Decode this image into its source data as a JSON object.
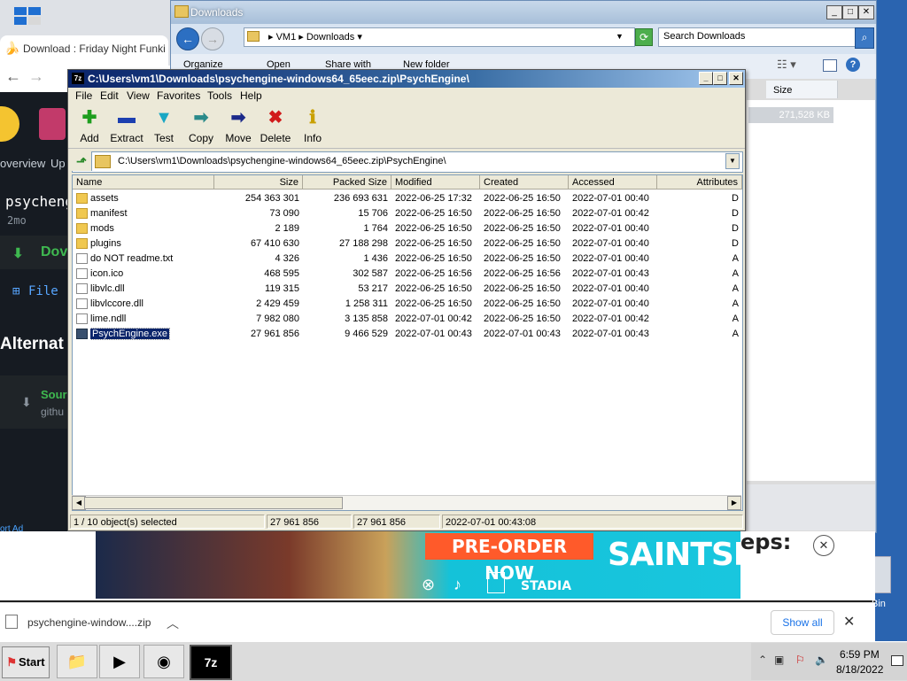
{
  "browser": {
    "tab_title": "Download : Friday Night Funkin' -",
    "back_glyph": "←",
    "forward_glyph": "→",
    "page": {
      "nav_overview": "overview",
      "nav_up": "Up",
      "heading": "psycheng",
      "meta": "2mo",
      "download_btn": "Dov",
      "file_label": "File",
      "alternate_heading": "Alternat",
      "source_label": "Sour",
      "source_sub": "githu",
      "report_ad": "ort Ad"
    }
  },
  "explorer": {
    "title": "Downloads",
    "breadcrumb": [
      "VM1",
      "Downloads"
    ],
    "search_placeholder": "Search Downloads",
    "commands": [
      "Organize",
      "Open",
      "Share with",
      "New folder"
    ],
    "size_header": "Size",
    "size_value": "271,528 KB"
  },
  "sevenzip": {
    "title": "C:\\Users\\vm1\\Downloads\\psychengine-windows64_65eec.zip\\PsychEngine\\",
    "icon_text": "7z",
    "menu": [
      "File",
      "Edit",
      "View",
      "Favorites",
      "Tools",
      "Help"
    ],
    "toolbar": [
      {
        "label": "Add",
        "icon": "plus-icon",
        "glyph": "✚",
        "color": "#1e9e1e"
      },
      {
        "label": "Extract",
        "icon": "minus-icon",
        "glyph": "▬",
        "color": "#1c3fb0"
      },
      {
        "label": "Test",
        "icon": "check-icon",
        "glyph": "▼",
        "color": "#19a7c4"
      },
      {
        "label": "Copy",
        "icon": "copy-arrow-icon",
        "glyph": "➡",
        "color": "#2a8a8a"
      },
      {
        "label": "Move",
        "icon": "move-arrow-icon",
        "glyph": "➡",
        "color": "#1c2a8a"
      },
      {
        "label": "Delete",
        "icon": "delete-x-icon",
        "glyph": "✖",
        "color": "#d11a1a"
      },
      {
        "label": "Info",
        "icon": "info-icon",
        "glyph": "ℹ",
        "color": "#c9a000"
      }
    ],
    "path": "C:\\Users\\vm1\\Downloads\\psychengine-windows64_65eec.zip\\PsychEngine\\",
    "columns": [
      "Name",
      "Size",
      "Packed Size",
      "Modified",
      "Created",
      "Accessed",
      "Attributes"
    ],
    "rows": [
      {
        "name": "assets",
        "type": "folder",
        "size": "254 363 301",
        "packed": "236 693 631",
        "modified": "2022-06-25 17:32",
        "created": "2022-06-25 16:50",
        "accessed": "2022-07-01 00:40",
        "attr": "D"
      },
      {
        "name": "manifest",
        "type": "folder",
        "size": "73 090",
        "packed": "15 706",
        "modified": "2022-06-25 16:50",
        "created": "2022-06-25 16:50",
        "accessed": "2022-07-01 00:42",
        "attr": "D"
      },
      {
        "name": "mods",
        "type": "folder",
        "size": "2 189",
        "packed": "1 764",
        "modified": "2022-06-25 16:50",
        "created": "2022-06-25 16:50",
        "accessed": "2022-07-01 00:40",
        "attr": "D"
      },
      {
        "name": "plugins",
        "type": "folder",
        "size": "67 410 630",
        "packed": "27 188 298",
        "modified": "2022-06-25 16:50",
        "created": "2022-06-25 16:50",
        "accessed": "2022-07-01 00:40",
        "attr": "D"
      },
      {
        "name": "do NOT readme.txt",
        "type": "file",
        "size": "4 326",
        "packed": "1 436",
        "modified": "2022-06-25 16:50",
        "created": "2022-06-25 16:50",
        "accessed": "2022-07-01 00:40",
        "attr": "A"
      },
      {
        "name": "icon.ico",
        "type": "file",
        "size": "468 595",
        "packed": "302 587",
        "modified": "2022-06-25 16:56",
        "created": "2022-06-25 16:56",
        "accessed": "2022-07-01 00:43",
        "attr": "A"
      },
      {
        "name": "libvlc.dll",
        "type": "dll",
        "size": "119 315",
        "packed": "53 217",
        "modified": "2022-06-25 16:50",
        "created": "2022-06-25 16:50",
        "accessed": "2022-07-01 00:40",
        "attr": "A"
      },
      {
        "name": "libvlccore.dll",
        "type": "dll",
        "size": "2 429 459",
        "packed": "1 258 311",
        "modified": "2022-06-25 16:50",
        "created": "2022-06-25 16:50",
        "accessed": "2022-07-01 00:40",
        "attr": "A"
      },
      {
        "name": "lime.ndll",
        "type": "file",
        "size": "7 982 080",
        "packed": "3 135 858",
        "modified": "2022-07-01 00:42",
        "created": "2022-06-25 16:50",
        "accessed": "2022-07-01 00:42",
        "attr": "A"
      },
      {
        "name": "PsychEngine.exe",
        "type": "exe",
        "size": "27 961 856",
        "packed": "9 466 529",
        "modified": "2022-07-01 00:43",
        "created": "2022-07-01 00:43",
        "accessed": "2022-07-01 00:43",
        "attr": "A",
        "selected": true
      }
    ],
    "status": {
      "selection": "1 / 10 object(s) selected",
      "size": "27 961 856",
      "packed": "27 961 856",
      "modified": "2022-07-01 00:43:08"
    }
  },
  "ad": {
    "preorder": "PRE-ORDER NOW",
    "logo": "SAINTSROW",
    "platform": "STADIA",
    "tagline": "eps:",
    "close_glyph": "✕"
  },
  "download_bar": {
    "filename": "psychengine-window....zip",
    "show_all": "Show all",
    "close_glyph": "✕"
  },
  "desktop": {
    "recycle_label": "Bin"
  },
  "taskbar": {
    "start_label": "Start",
    "time": "6:59 PM",
    "date": "8/18/2022"
  }
}
